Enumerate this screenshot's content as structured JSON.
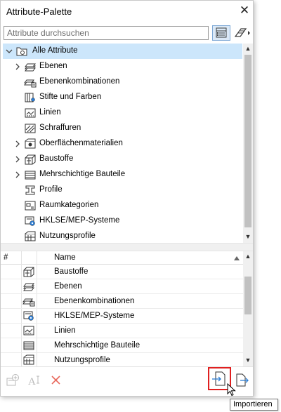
{
  "window": {
    "title": "Attribute-Palette"
  },
  "search": {
    "placeholder": "Attribute durchsuchen"
  },
  "tree": {
    "root": {
      "label": "Alle Attribute",
      "expanded": true,
      "selected": true
    },
    "items": [
      {
        "label": "Ebenen",
        "icon": "layers-icon",
        "expandable": true
      },
      {
        "label": "Ebenenkombinationen",
        "icon": "layer-combinations-icon",
        "expandable": false
      },
      {
        "label": "Stifte und Farben",
        "icon": "pens-colors-icon",
        "expandable": false
      },
      {
        "label": "Linien",
        "icon": "line-types-icon",
        "expandable": false
      },
      {
        "label": "Schraffuren",
        "icon": "fills-icon",
        "expandable": false
      },
      {
        "label": "Oberflächenmaterialien",
        "icon": "surfaces-icon",
        "expandable": true
      },
      {
        "label": "Baustoffe",
        "icon": "building-materials-icon",
        "expandable": true
      },
      {
        "label": "Mehrschichtige Bauteile",
        "icon": "composites-icon",
        "expandable": true
      },
      {
        "label": "Profile",
        "icon": "profiles-icon",
        "expandable": false
      },
      {
        "label": "Raumkategorien",
        "icon": "zone-categories-icon",
        "expandable": false
      },
      {
        "label": "HKLSE/MEP-Systeme",
        "icon": "mep-systems-icon",
        "expandable": false
      },
      {
        "label": "Nutzungsprofile",
        "icon": "operation-profiles-icon",
        "expandable": false
      }
    ]
  },
  "list": {
    "columns": {
      "hash": "#",
      "name": "Name"
    },
    "sort_icon": "sort-asc-icon",
    "rows": [
      {
        "name": "Baustoffe",
        "icon": "building-materials-icon"
      },
      {
        "name": "Ebenen",
        "icon": "layers-icon"
      },
      {
        "name": "Ebenenkombinationen",
        "icon": "layer-combinations-icon"
      },
      {
        "name": "HKLSE/MEP-Systeme",
        "icon": "mep-systems-icon"
      },
      {
        "name": "Linien",
        "icon": "line-types-icon"
      },
      {
        "name": "Mehrschichtige Bauteile",
        "icon": "composites-icon"
      },
      {
        "name": "Nutzungsprofile",
        "icon": "operation-profiles-icon"
      }
    ]
  },
  "footer": {
    "new_icon": "new-attribute-icon",
    "rename_icon": "rename-icon",
    "delete_icon": "delete-icon",
    "import_icon": "import-icon",
    "export_icon": "export-icon",
    "tooltip": "Importieren"
  },
  "colors": {
    "selection": "#cce6fb",
    "accent": "#2b7cd3",
    "highlight": "#e02020",
    "delete": "#e8685c"
  }
}
